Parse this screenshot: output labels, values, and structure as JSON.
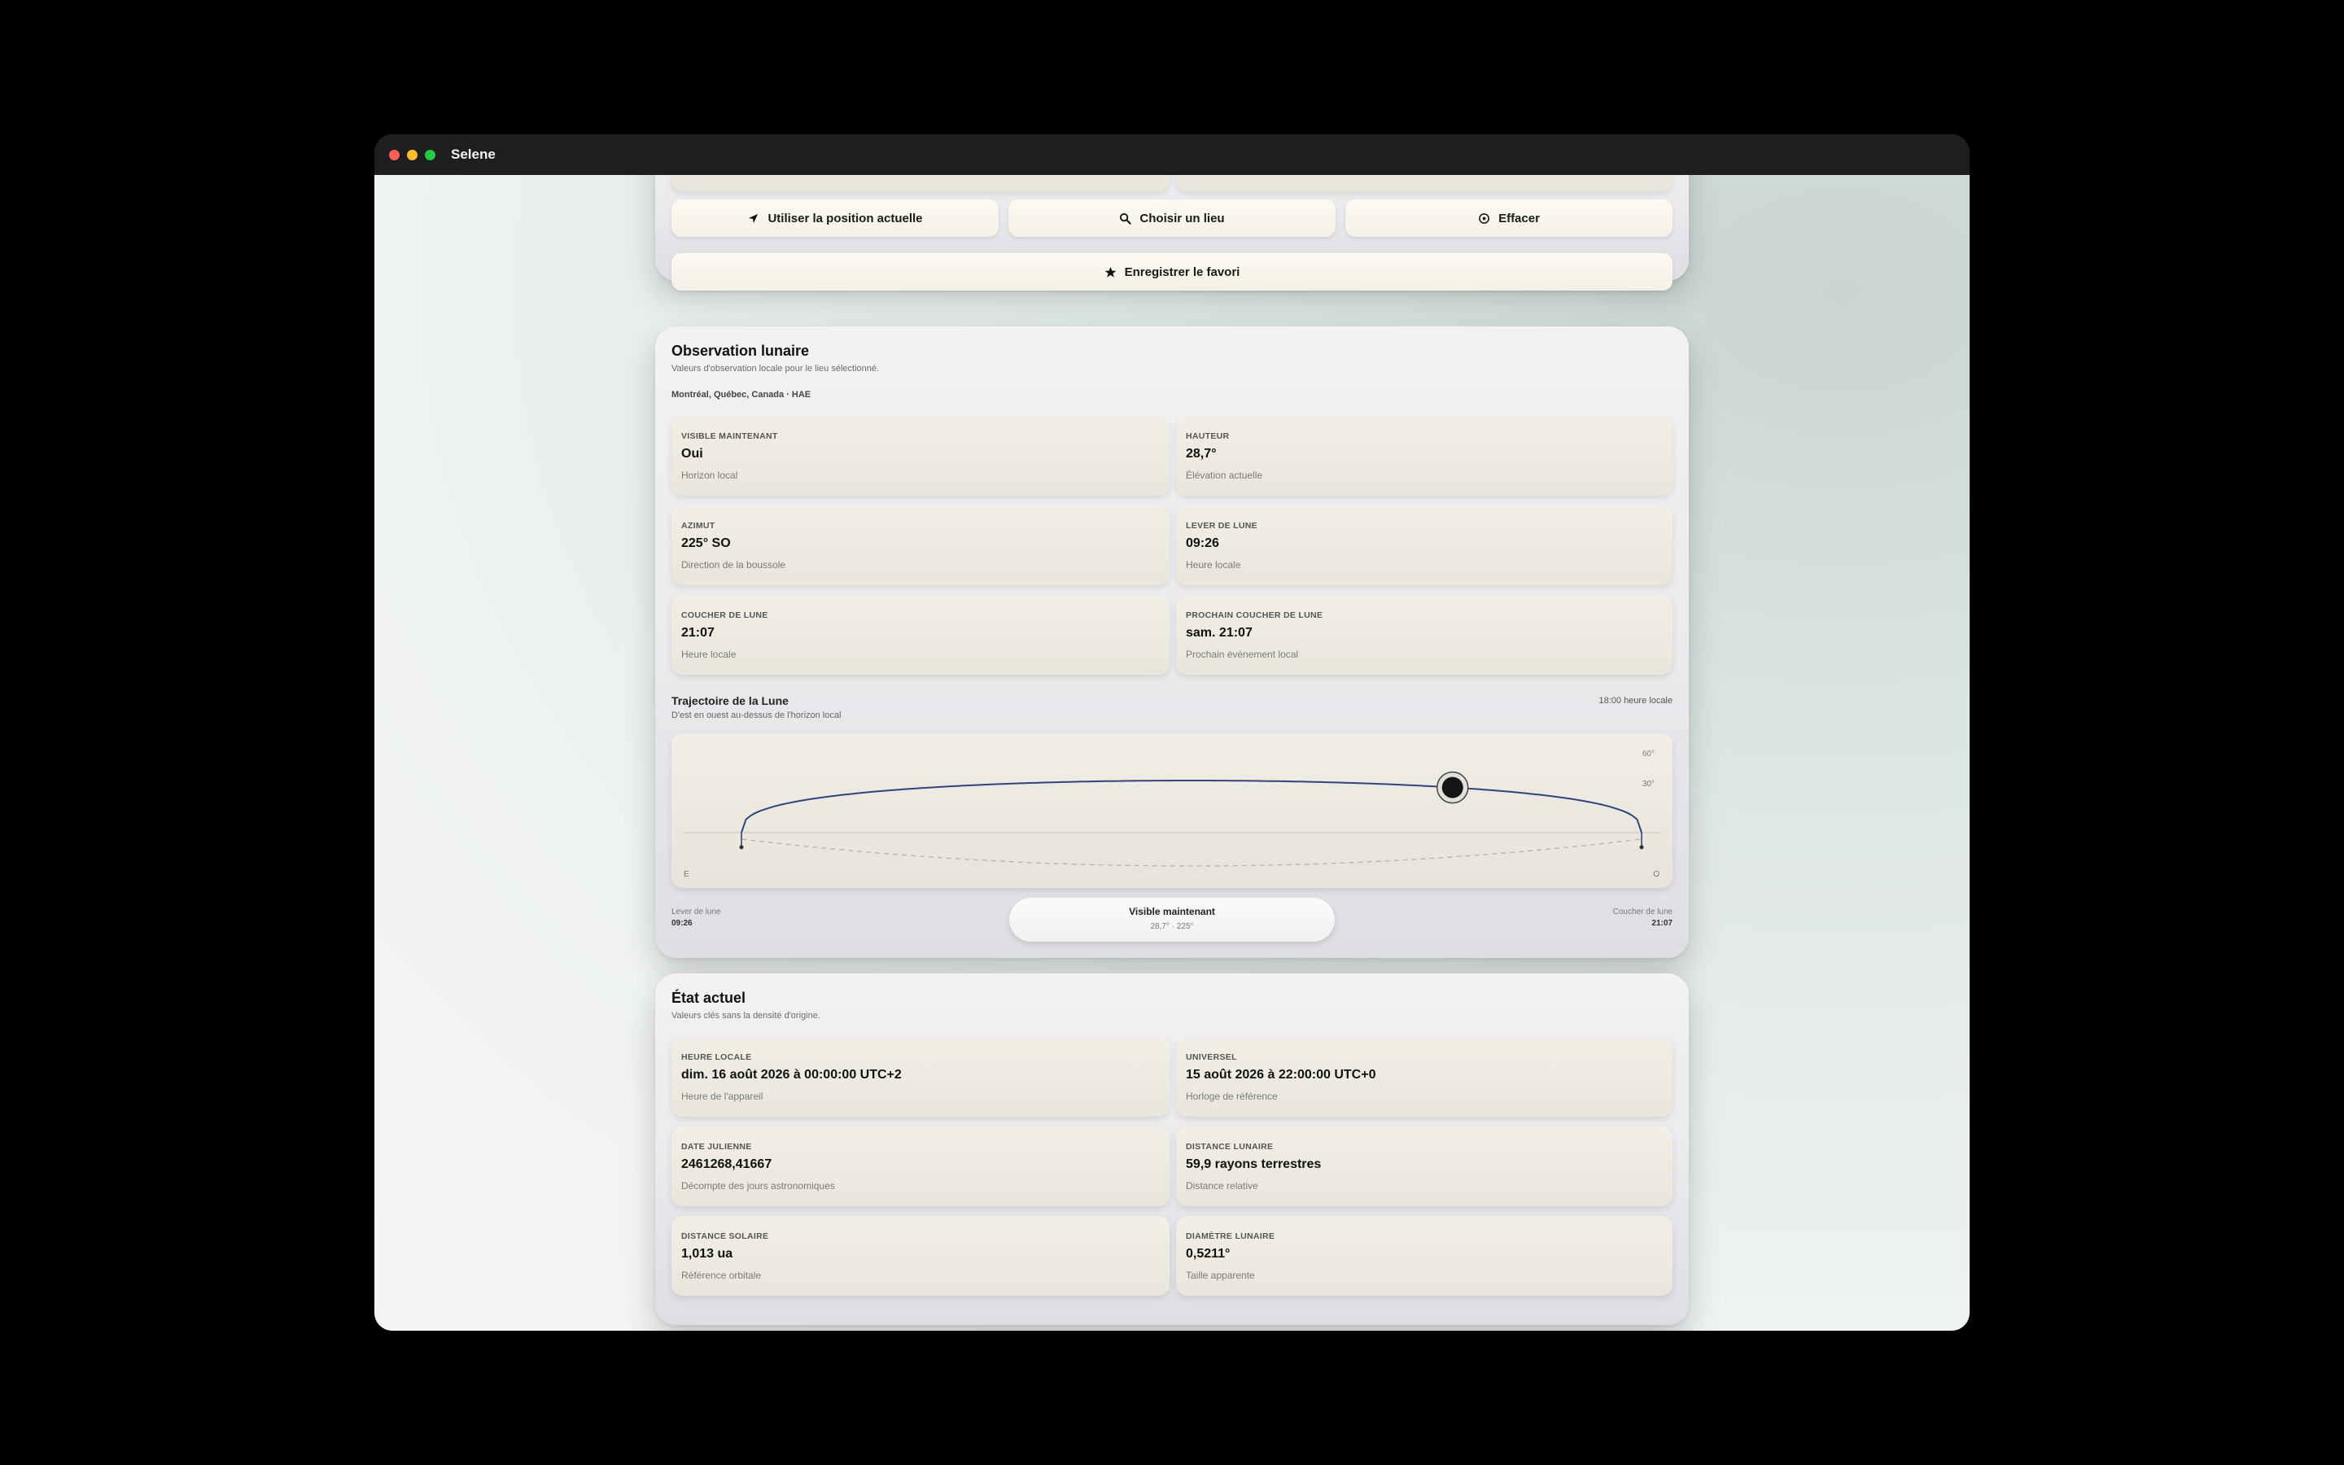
{
  "window": {
    "title": "Selene"
  },
  "location_actions": {
    "use_current": "Utiliser la position actuelle",
    "choose_place": "Choisir un lieu",
    "clear": "Effacer",
    "save_favorite": "Enregistrer le favori"
  },
  "observation": {
    "title": "Observation lunaire",
    "subtitle": "Valeurs d'observation locale pour le lieu sélectionné.",
    "location": "Montréal, Québec, Canada · HAE",
    "cards": [
      {
        "label": "VISIBLE MAINTENANT",
        "value": "Oui",
        "hint": "Horizon local"
      },
      {
        "label": "HAUTEUR",
        "value": "28,7°",
        "hint": "Élévation actuelle"
      },
      {
        "label": "AZIMUT",
        "value": "225° SO",
        "hint": "Direction de la boussole"
      },
      {
        "label": "LEVER DE LUNE",
        "value": "09:26",
        "hint": "Heure locale"
      },
      {
        "label": "COUCHER DE LUNE",
        "value": "21:07",
        "hint": "Heure locale"
      },
      {
        "label": "PROCHAIN COUCHER DE LUNE",
        "value": "sam. 21:07",
        "hint": "Prochain événement local"
      }
    ],
    "trajectory": {
      "title": "Trajectoire de la Lune",
      "subtitle": "D'est en ouest au-dessus de l'horizon local",
      "time": "18:00 heure locale",
      "axis_60": "60°",
      "axis_30": "30°",
      "east": "E",
      "west": "O",
      "moonrise_label": "Lever de lune",
      "moonrise_time": "09:26",
      "moonset_label": "Coucher de lune",
      "moonset_time": "21:07",
      "status": "Visible maintenant",
      "status_detail": "28,7° · 225°",
      "current_progress": 0.79
    }
  },
  "current_state": {
    "title": "État actuel",
    "subtitle": "Valeurs clés sans la densité d'origine.",
    "cards": [
      {
        "label": "HEURE LOCALE",
        "value": "dim. 16 août 2026 à 00:00:00 UTC+2",
        "hint": "Heure de l'appareil"
      },
      {
        "label": "UNIVERSEL",
        "value": "15 août 2026 à 22:00:00 UTC+0",
        "hint": "Horloge de référence"
      },
      {
        "label": "DATE JULIENNE",
        "value": "2461268,41667",
        "hint": "Décompte des jours astronomiques"
      },
      {
        "label": "DISTANCE LUNAIRE",
        "value": "59,9 rayons terrestres",
        "hint": "Distance relative"
      },
      {
        "label": "DISTANCE SOLAIRE",
        "value": "1,013 ua",
        "hint": "Référence orbitale"
      },
      {
        "label": "DIAMÈTRE LUNAIRE",
        "value": "0,5211°",
        "hint": "Taille apparente"
      }
    ]
  }
}
